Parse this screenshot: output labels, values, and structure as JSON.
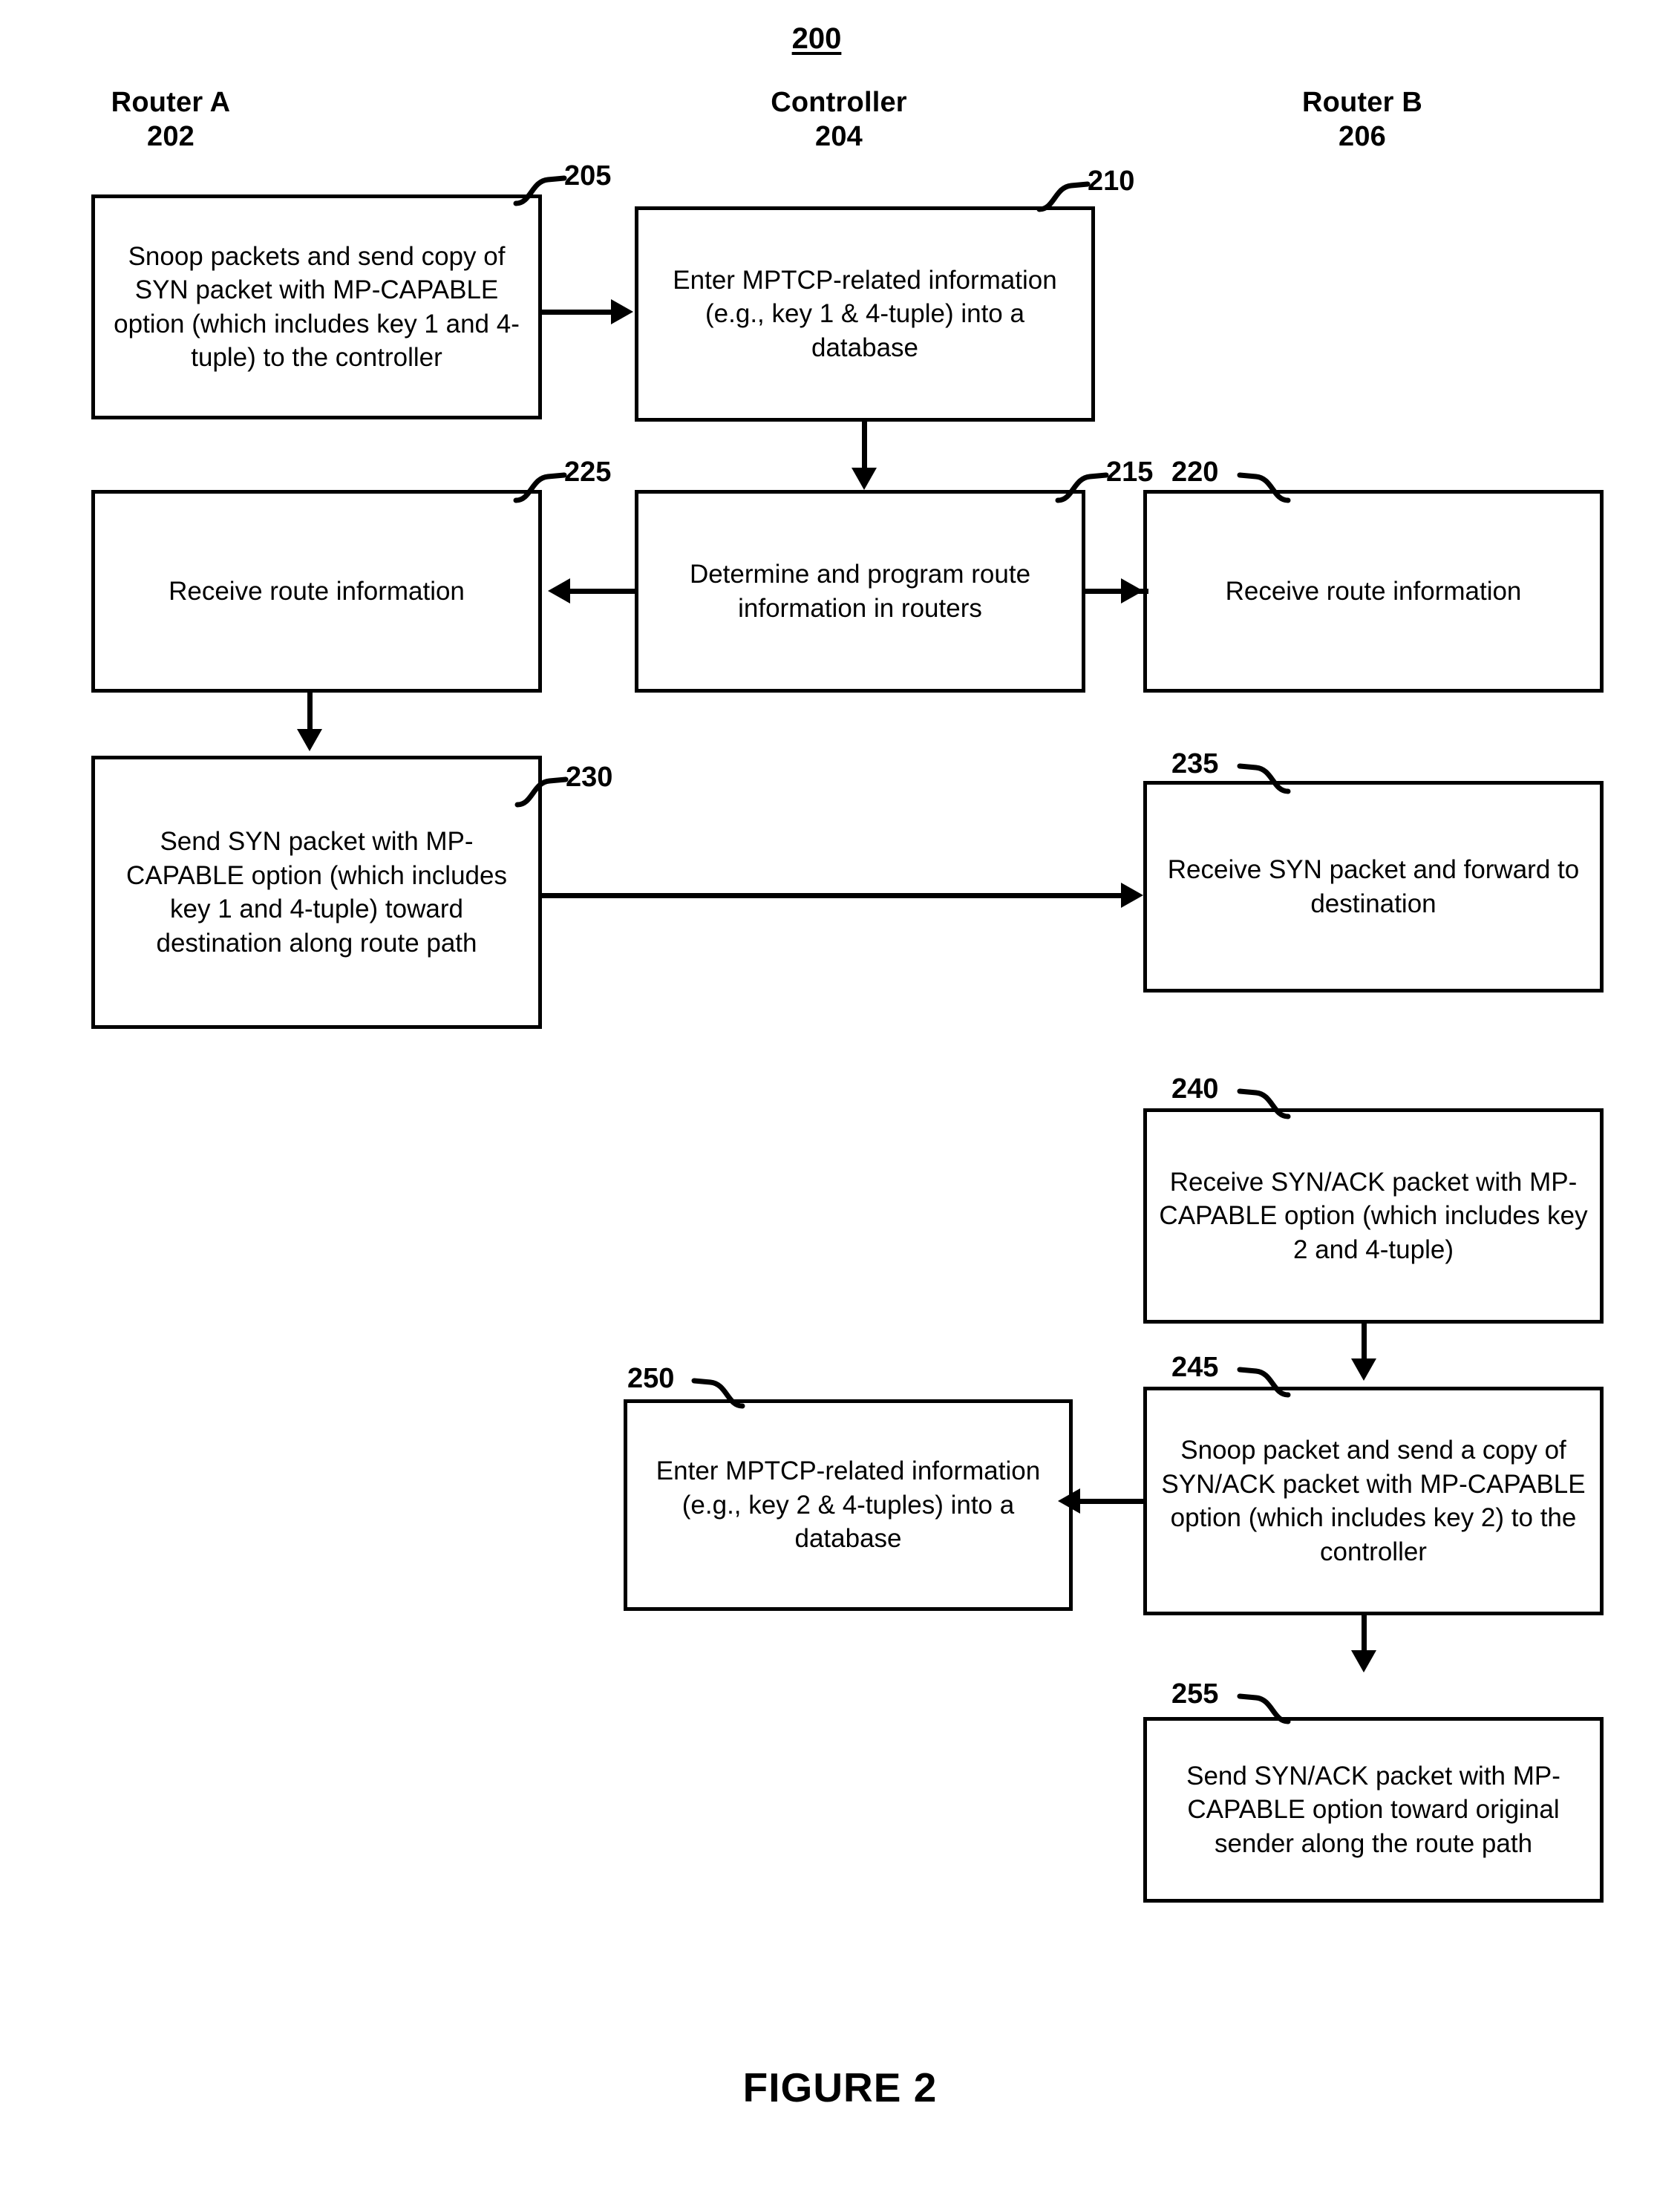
{
  "figure": {
    "figure_number_label": "200",
    "caption": "FIGURE 2"
  },
  "columns": [
    {
      "name": "Router A",
      "number": "202"
    },
    {
      "name": "Controller",
      "number": "204"
    },
    {
      "name": "Router B",
      "number": "206"
    }
  ],
  "boxes": [
    {
      "ref": "205",
      "column": "Router A",
      "text": "Snoop packets and send copy of SYN packet with MP-CAPABLE option (which includes key 1 and 4-tuple) to the controller"
    },
    {
      "ref": "210",
      "column": "Controller",
      "text": "Enter MPTCP-related information (e.g., key  1 & 4-tuple) into a database"
    },
    {
      "ref": "225",
      "column": "Router A",
      "text": "Receive route information"
    },
    {
      "ref": "215",
      "column": "Controller",
      "text": "Determine and program route information in routers"
    },
    {
      "ref": "220",
      "column": "Router B",
      "text": "Receive route information"
    },
    {
      "ref": "230",
      "column": "Router A",
      "text": "Send SYN packet with MP-CAPABLE option (which includes key 1 and 4-tuple) toward destination along route path"
    },
    {
      "ref": "235",
      "column": "Router B",
      "text": "Receive SYN packet and forward to destination"
    },
    {
      "ref": "240",
      "column": "Router B",
      "text": "Receive SYN/ACK packet with MP-CAPABLE option (which includes key 2 and 4-tuple)"
    },
    {
      "ref": "245",
      "column": "Router B",
      "text": "Snoop packet and send a copy of SYN/ACK packet with MP-CAPABLE option (which includes key 2) to the controller"
    },
    {
      "ref": "250",
      "column": "Controller",
      "text": "Enter MPTCP-related information (e.g., key 2 & 4-tuples) into a database"
    },
    {
      "ref": "255",
      "column": "Router B",
      "text": "Send SYN/ACK packet with MP-CAPABLE option toward original sender along the route path"
    }
  ]
}
